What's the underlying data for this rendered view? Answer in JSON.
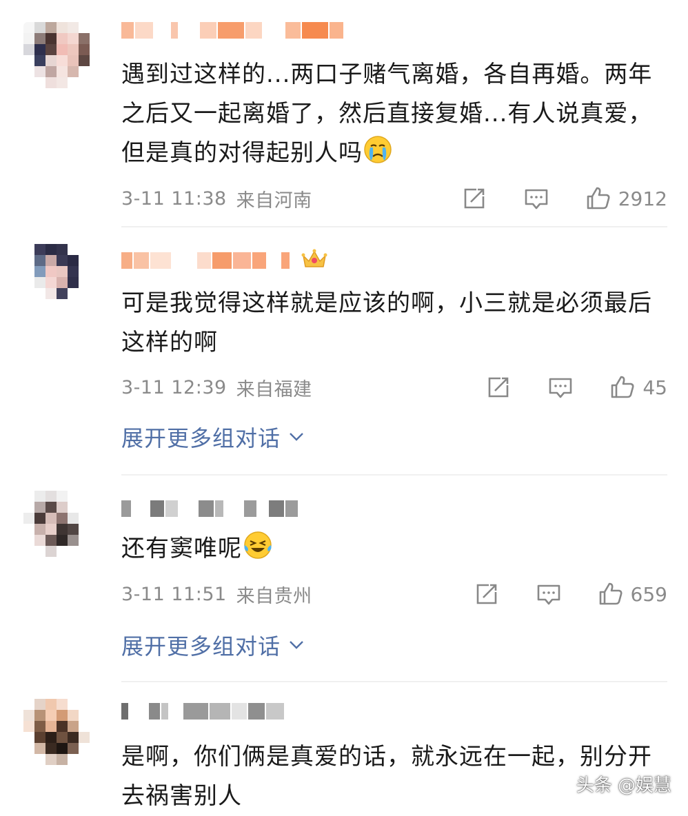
{
  "comments": [
    {
      "text": "遇到过这样的...两口子赌气离婚，各自再婚。两年之后又一起离婚了，然后直接复婚...有人说真爱，但是真的对得起别人吗",
      "emoji": "crying-face",
      "date": "3-11 11:38",
      "location": "来自河南",
      "likes": "2912"
    },
    {
      "text": "可是我觉得这样就是应该的啊，小三就是必须最后这样的啊",
      "date": "3-11 12:39",
      "location": "来自福建",
      "likes": "45",
      "badge": "crown-icon",
      "expand_label": "展开更多组对话"
    },
    {
      "text": "还有窦唯呢",
      "emoji": "laughing-tears-face",
      "date": "3-11 11:51",
      "location": "来自贵州",
      "likes": "659",
      "expand_label": "展开更多组对话"
    },
    {
      "text": "是啊，你们俩是真爱的话，就永远在一起，别分开去祸害别人"
    }
  ],
  "watermark": "头条 @娱慧",
  "colors": {
    "link": "#506fa6",
    "meta": "#8a8a8a",
    "text": "#1a1a1a"
  }
}
